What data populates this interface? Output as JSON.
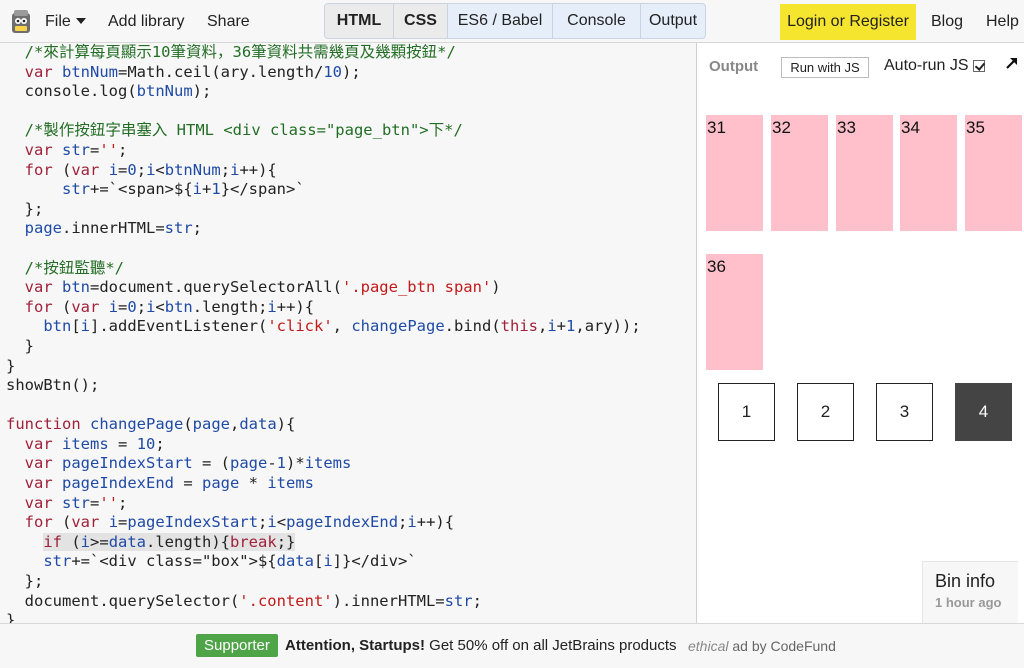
{
  "topbar": {
    "file_label": "File",
    "add_library_label": "Add library",
    "share_label": "Share",
    "tabs": [
      {
        "label": "HTML",
        "active": true
      },
      {
        "label": "CSS",
        "active": true
      },
      {
        "label": "ES6 / Babel",
        "active": false
      },
      {
        "label": "Console",
        "active": false
      },
      {
        "label": "Output",
        "active": false
      }
    ],
    "login_label": "Login or Register",
    "blog_label": "Blog",
    "help_label": "Help",
    "accent_color": "#f6e52e"
  },
  "editor": {
    "lines": [
      "  /*來計算每頁顯示10筆資料，36筆資料共需幾頁及幾顆按鈕*/",
      "  var btnNum=Math.ceil(ary.length/10);",
      "  console.log(btnNum);",
      "",
      "  /*製作按鈕字串塞入 HTML <div class=\"page_btn\">下*/",
      "  var str='';",
      "  for (var i=0;i<btnNum;i++){",
      "      str+=`<span>${i+1}</span>`",
      "  };",
      "  page.innerHTML=str;",
      "",
      "  /*按鈕監聽*/",
      "  var btn=document.querySelectorAll('.page_btn span')",
      "  for (var i=0;i<btn.length;i++){",
      "    btn[i].addEventListener('click', changePage.bind(this,i+1,ary));",
      "  }",
      "}",
      "showBtn();",
      "",
      "function changePage(page,data){",
      "  var items = 10;",
      "  var pageIndexStart = (page-1)*items",
      "  var pageIndexEnd = page * items",
      "  var str='';",
      "  for (var i=pageIndexStart;i<pageIndexEnd;i++){",
      "    if (i>=data.length){break;}",
      "    str+=`<div class=\"box\">${data[i]}</div>`",
      "  };",
      "  document.querySelector('.content').innerHTML=str;",
      "}"
    ]
  },
  "output": {
    "label": "Output",
    "run_button_label": "Run with JS",
    "autorun_label": "Auto-run JS",
    "autorun_checked": true,
    "boxes": [
      "31",
      "32",
      "33",
      "34",
      "35",
      "36"
    ],
    "page_buttons": [
      {
        "label": "1",
        "active": false
      },
      {
        "label": "2",
        "active": false
      },
      {
        "label": "3",
        "active": false
      },
      {
        "label": "4",
        "active": true
      }
    ],
    "box_color": "#ffc0cb",
    "active_button_color": "#444444"
  },
  "bin_info": {
    "title": "Bin info",
    "time": "1 hour ago"
  },
  "adbar": {
    "supporter_label": "Supporter",
    "headline": "Attention, Startups!",
    "body": " Get 50% off on all JetBrains products",
    "ethical": "ethical",
    "credit": " ad by CodeFund",
    "supporter_color": "#4fa447"
  }
}
